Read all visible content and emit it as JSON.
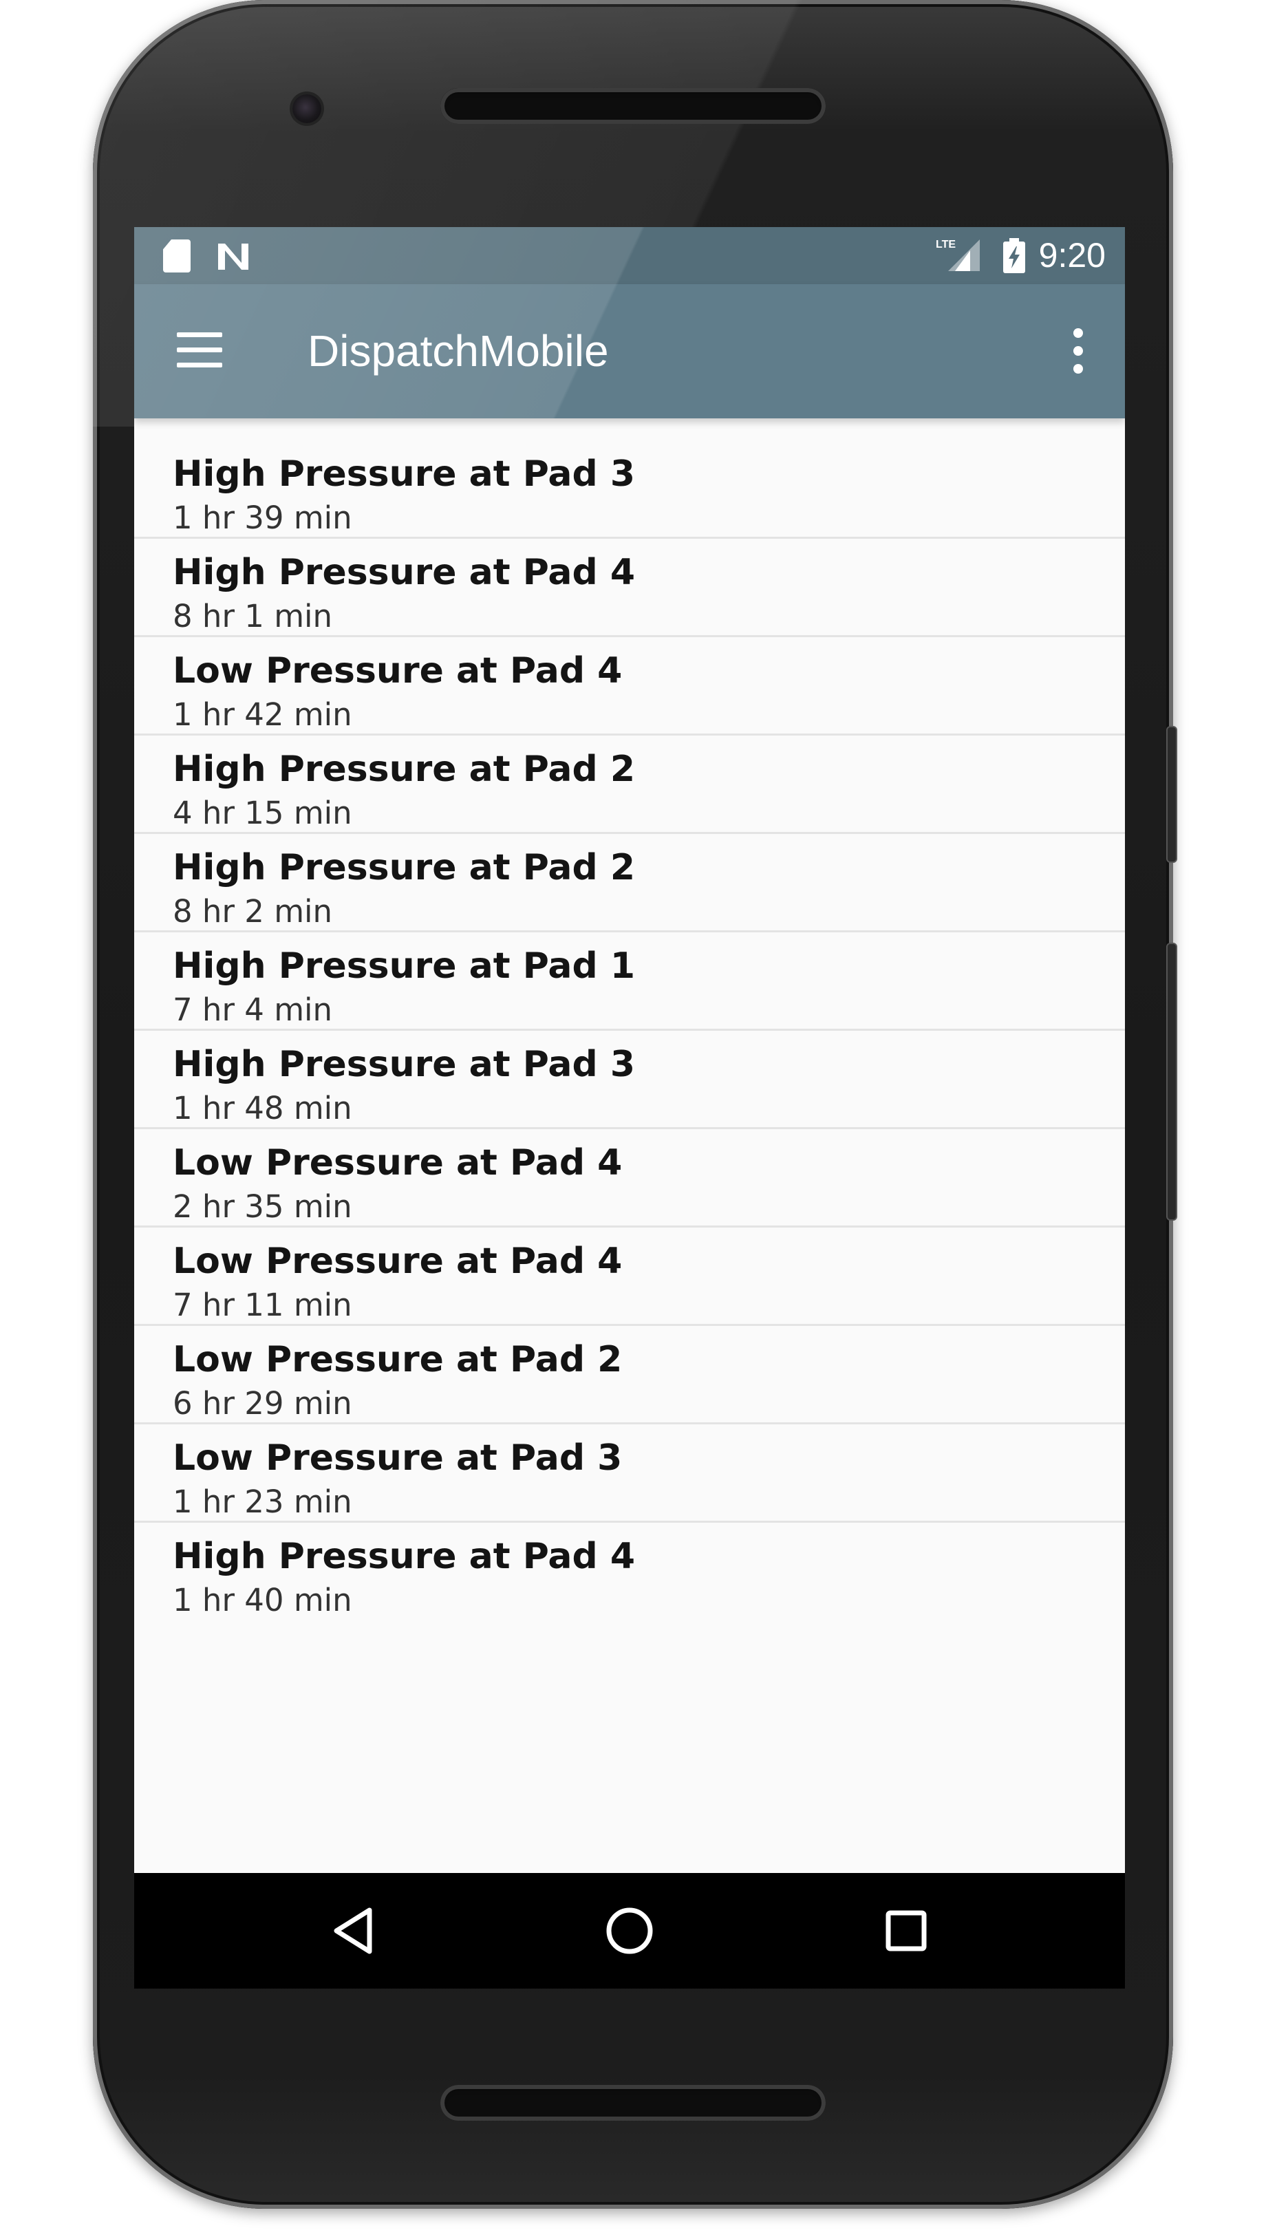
{
  "status_bar": {
    "time": "9:20",
    "network_label": "LTE",
    "icons": [
      "sd-card-icon",
      "n-notification-icon",
      "lte-signal-icon",
      "battery-charging-icon"
    ]
  },
  "toolbar": {
    "title": "DispatchMobile",
    "menu_icon": "hamburger-menu-icon",
    "overflow_icon": "more-vert-icon",
    "color": "#607d8b",
    "status_color": "#546e7a"
  },
  "alerts": [
    {
      "title": "High Pressure at Pad 3",
      "time": "1 hr 39 min"
    },
    {
      "title": "High Pressure at Pad 4",
      "time": "8 hr 1 min"
    },
    {
      "title": "Low Pressure at Pad 4",
      "time": "1 hr 42 min"
    },
    {
      "title": "High Pressure at Pad 2",
      "time": "4 hr 15 min"
    },
    {
      "title": "High Pressure at Pad 2",
      "time": "8 hr 2 min"
    },
    {
      "title": "High Pressure at Pad 1",
      "time": "7 hr 4 min"
    },
    {
      "title": "High Pressure at Pad 3",
      "time": "1 hr 48 min"
    },
    {
      "title": "Low Pressure at Pad 4",
      "time": "2 hr 35 min"
    },
    {
      "title": "Low Pressure at Pad 4",
      "time": "7 hr 11 min"
    },
    {
      "title": "Low Pressure at Pad 2",
      "time": "6 hr 29 min"
    },
    {
      "title": "Low Pressure at Pad 3",
      "time": "1 hr 23 min"
    },
    {
      "title": "High Pressure at Pad 4",
      "time": "1 hr 40 min"
    }
  ],
  "nav_bar": {
    "buttons": [
      "back-triangle-icon",
      "home-circle-icon",
      "recents-square-icon"
    ]
  }
}
